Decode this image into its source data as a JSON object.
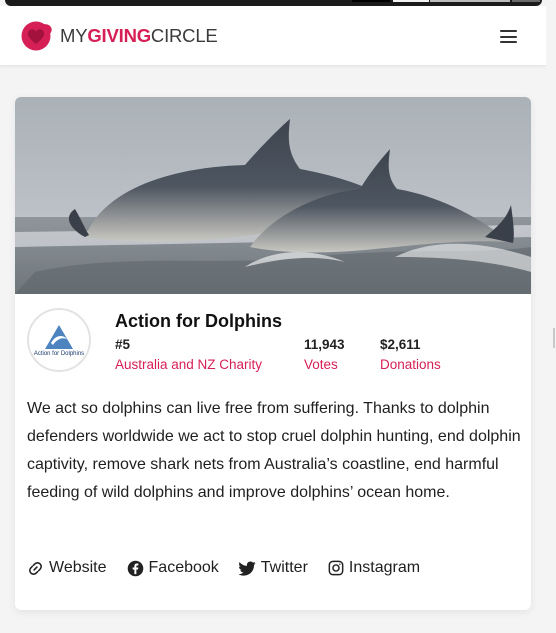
{
  "header": {
    "logo_part1": "MY",
    "logo_part2": "GIVING",
    "logo_part3": "CIRCLE",
    "menu_icon": "hamburger-menu-icon"
  },
  "charity": {
    "name": "Action for Dolphins",
    "badge_text": "Action for Dolphins",
    "rank": "#5",
    "category": "Australia and NZ Charity",
    "votes": "11,943",
    "votes_label": "Votes",
    "donations": "$2,611",
    "donations_label": "Donations",
    "description": "We act so dolphins can live free from suffering. Thanks to dolphin defenders worldwide we act to stop cruel dolphin hunting, end dolphin captivity, remove shark nets from Australia’s coastline, end harmful feeding of wild dolphins and improve dolphins’ ocean home."
  },
  "links": [
    {
      "label": "Website",
      "icon": "link-icon"
    },
    {
      "label": "Facebook",
      "icon": "facebook-icon"
    },
    {
      "label": "Twitter",
      "icon": "twitter-icon"
    },
    {
      "label": "Instagram",
      "icon": "instagram-icon"
    }
  ],
  "colors": {
    "brand": "#d61f55",
    "text": "#1f1f1f"
  }
}
